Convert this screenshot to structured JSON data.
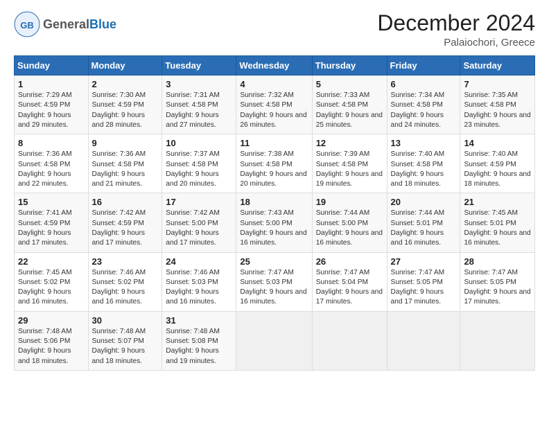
{
  "logo": {
    "general": "General",
    "blue": "Blue"
  },
  "header": {
    "month_title": "December 2024",
    "location": "Palaiochori, Greece"
  },
  "weekdays": [
    "Sunday",
    "Monday",
    "Tuesday",
    "Wednesday",
    "Thursday",
    "Friday",
    "Saturday"
  ],
  "weeks": [
    [
      {
        "day": "1",
        "sunrise": "7:29 AM",
        "sunset": "4:59 PM",
        "daylight": "9 hours and 29 minutes."
      },
      {
        "day": "2",
        "sunrise": "7:30 AM",
        "sunset": "4:59 PM",
        "daylight": "9 hours and 28 minutes."
      },
      {
        "day": "3",
        "sunrise": "7:31 AM",
        "sunset": "4:58 PM",
        "daylight": "9 hours and 27 minutes."
      },
      {
        "day": "4",
        "sunrise": "7:32 AM",
        "sunset": "4:58 PM",
        "daylight": "9 hours and 26 minutes."
      },
      {
        "day": "5",
        "sunrise": "7:33 AM",
        "sunset": "4:58 PM",
        "daylight": "9 hours and 25 minutes."
      },
      {
        "day": "6",
        "sunrise": "7:34 AM",
        "sunset": "4:58 PM",
        "daylight": "9 hours and 24 minutes."
      },
      {
        "day": "7",
        "sunrise": "7:35 AM",
        "sunset": "4:58 PM",
        "daylight": "9 hours and 23 minutes."
      }
    ],
    [
      {
        "day": "8",
        "sunrise": "7:36 AM",
        "sunset": "4:58 PM",
        "daylight": "9 hours and 22 minutes."
      },
      {
        "day": "9",
        "sunrise": "7:36 AM",
        "sunset": "4:58 PM",
        "daylight": "9 hours and 21 minutes."
      },
      {
        "day": "10",
        "sunrise": "7:37 AM",
        "sunset": "4:58 PM",
        "daylight": "9 hours and 20 minutes."
      },
      {
        "day": "11",
        "sunrise": "7:38 AM",
        "sunset": "4:58 PM",
        "daylight": "9 hours and 20 minutes."
      },
      {
        "day": "12",
        "sunrise": "7:39 AM",
        "sunset": "4:58 PM",
        "daylight": "9 hours and 19 minutes."
      },
      {
        "day": "13",
        "sunrise": "7:40 AM",
        "sunset": "4:58 PM",
        "daylight": "9 hours and 18 minutes."
      },
      {
        "day": "14",
        "sunrise": "7:40 AM",
        "sunset": "4:59 PM",
        "daylight": "9 hours and 18 minutes."
      }
    ],
    [
      {
        "day": "15",
        "sunrise": "7:41 AM",
        "sunset": "4:59 PM",
        "daylight": "9 hours and 17 minutes."
      },
      {
        "day": "16",
        "sunrise": "7:42 AM",
        "sunset": "4:59 PM",
        "daylight": "9 hours and 17 minutes."
      },
      {
        "day": "17",
        "sunrise": "7:42 AM",
        "sunset": "5:00 PM",
        "daylight": "9 hours and 17 minutes."
      },
      {
        "day": "18",
        "sunrise": "7:43 AM",
        "sunset": "5:00 PM",
        "daylight": "9 hours and 16 minutes."
      },
      {
        "day": "19",
        "sunrise": "7:44 AM",
        "sunset": "5:00 PM",
        "daylight": "9 hours and 16 minutes."
      },
      {
        "day": "20",
        "sunrise": "7:44 AM",
        "sunset": "5:01 PM",
        "daylight": "9 hours and 16 minutes."
      },
      {
        "day": "21",
        "sunrise": "7:45 AM",
        "sunset": "5:01 PM",
        "daylight": "9 hours and 16 minutes."
      }
    ],
    [
      {
        "day": "22",
        "sunrise": "7:45 AM",
        "sunset": "5:02 PM",
        "daylight": "9 hours and 16 minutes."
      },
      {
        "day": "23",
        "sunrise": "7:46 AM",
        "sunset": "5:02 PM",
        "daylight": "9 hours and 16 minutes."
      },
      {
        "day": "24",
        "sunrise": "7:46 AM",
        "sunset": "5:03 PM",
        "daylight": "9 hours and 16 minutes."
      },
      {
        "day": "25",
        "sunrise": "7:47 AM",
        "sunset": "5:03 PM",
        "daylight": "9 hours and 16 minutes."
      },
      {
        "day": "26",
        "sunrise": "7:47 AM",
        "sunset": "5:04 PM",
        "daylight": "9 hours and 17 minutes."
      },
      {
        "day": "27",
        "sunrise": "7:47 AM",
        "sunset": "5:05 PM",
        "daylight": "9 hours and 17 minutes."
      },
      {
        "day": "28",
        "sunrise": "7:47 AM",
        "sunset": "5:05 PM",
        "daylight": "9 hours and 17 minutes."
      }
    ],
    [
      {
        "day": "29",
        "sunrise": "7:48 AM",
        "sunset": "5:06 PM",
        "daylight": "9 hours and 18 minutes."
      },
      {
        "day": "30",
        "sunrise": "7:48 AM",
        "sunset": "5:07 PM",
        "daylight": "9 hours and 18 minutes."
      },
      {
        "day": "31",
        "sunrise": "7:48 AM",
        "sunset": "5:08 PM",
        "daylight": "9 hours and 19 minutes."
      },
      null,
      null,
      null,
      null
    ]
  ]
}
